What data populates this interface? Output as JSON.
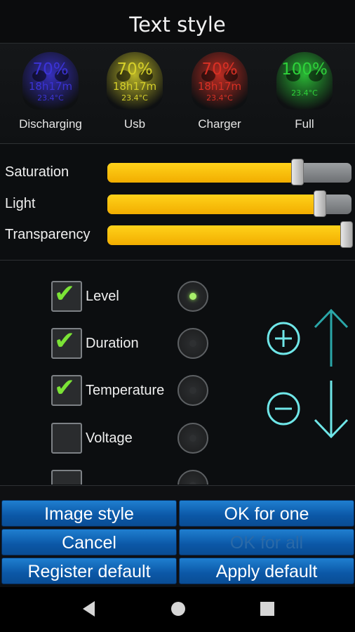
{
  "title": "Text style",
  "previews": [
    {
      "label": "Discharging",
      "level": "70%",
      "duration": "18h17m",
      "temperature": "23.4°C",
      "color": "#3b33d6"
    },
    {
      "label": "Usb",
      "level": "70%",
      "duration": "18h17m",
      "temperature": "23.4°C",
      "color": "#d6d02a"
    },
    {
      "label": "Charger",
      "level": "70%",
      "duration": "18h17m",
      "temperature": "23.4°C",
      "color": "#d83024"
    },
    {
      "label": "Full",
      "level": "100%",
      "duration": "",
      "temperature": "23.4°C",
      "color": "#2ed13a"
    }
  ],
  "sliders": [
    {
      "label": "Saturation",
      "value": 0.78
    },
    {
      "label": "Light",
      "value": 0.87
    },
    {
      "label": "Transparency",
      "value": 0.98
    }
  ],
  "options": [
    {
      "label": "Level",
      "checked": true,
      "selected": true
    },
    {
      "label": "Duration",
      "checked": true,
      "selected": false
    },
    {
      "label": "Temperature",
      "checked": true,
      "selected": false
    },
    {
      "label": "Voltage",
      "checked": false,
      "selected": false
    }
  ],
  "buttons": {
    "image_style": "Image style",
    "ok_for_one": "OK for one",
    "cancel": "Cancel",
    "ok_for_all": "OK for all",
    "register_default": "Register default",
    "apply_default": "Apply default"
  },
  "colors": {
    "accent_fill": "#f7be00",
    "check": "#7be336",
    "control_icon": "#6fe6e8",
    "button": "#0b57a6"
  },
  "icons": {
    "increase": "plus-circle-icon",
    "decrease": "minus-circle-icon",
    "up": "arrow-up-icon",
    "down": "arrow-down-icon"
  }
}
